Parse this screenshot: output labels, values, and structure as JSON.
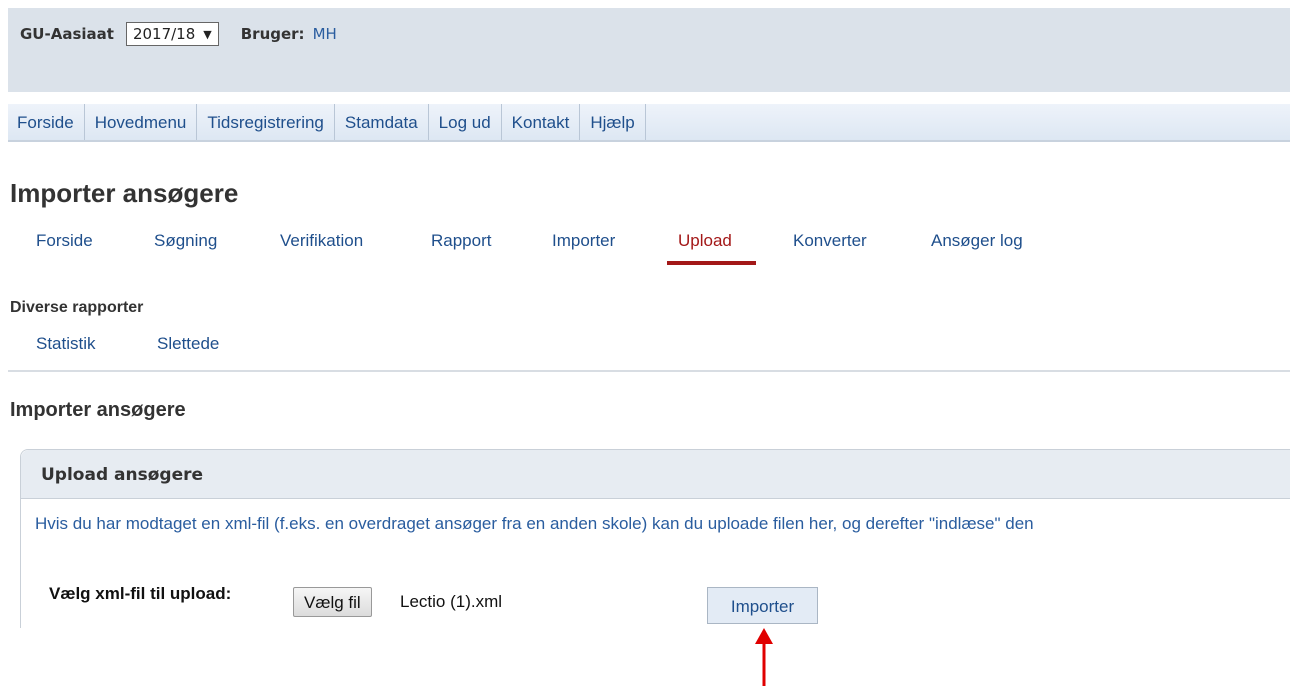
{
  "header": {
    "school": "GU-Aasiaat",
    "year": "2017/18",
    "year_arrow": "▼",
    "user_label": "Bruger:",
    "user_name": "MH"
  },
  "main_nav": [
    "Forside",
    "Hovedmenu",
    "Tidsregistrering",
    "Stamdata",
    "Log ud",
    "Kontakt",
    "Hjælp"
  ],
  "page_title": "Importer ansøgere",
  "sub_nav": {
    "items": [
      "Forside",
      "Søgning",
      "Verifikation",
      "Rapport",
      "Importer",
      "Upload",
      "Konverter",
      "Ansøger log"
    ],
    "active": "Upload"
  },
  "reports": {
    "label": "Diverse rapporter",
    "items": [
      "Statistik",
      "Slettede"
    ]
  },
  "section_title": "Importer ansøgere",
  "panel": {
    "title": "Upload ansøgere",
    "description": "Hvis du har modtaget en xml-fil (f.eks. en overdraget ansøger fra en anden skole) kan du uploade filen her, og derefter \"indlæse\" den",
    "file_label": "Vælg xml-fil til upload:",
    "choose_button": "Vælg fil",
    "file_name": "Lectio (1).xml",
    "import_button": "Importer"
  },
  "colors": {
    "link": "#1f4f8c",
    "active": "#a31818",
    "annotation_arrow": "#e00000",
    "header_bg": "#dbe2ea"
  }
}
